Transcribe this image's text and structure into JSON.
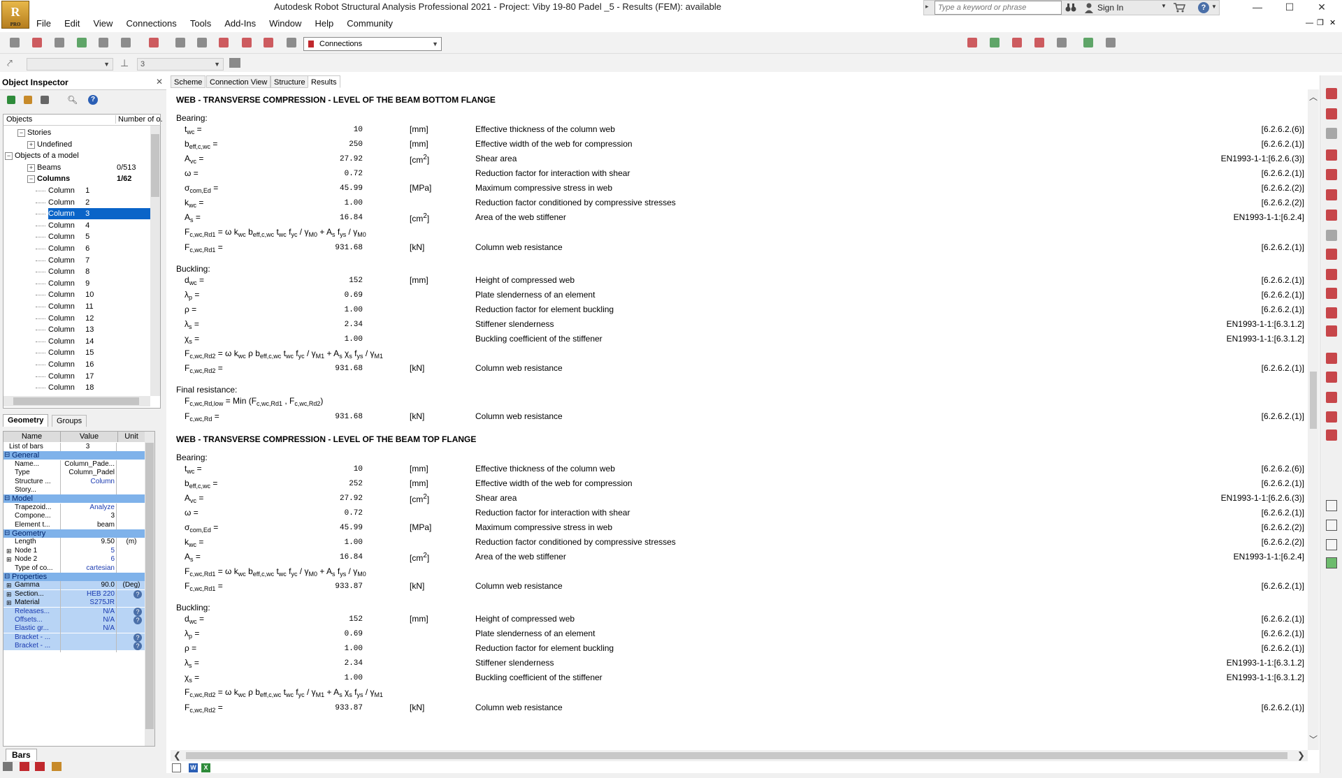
{
  "window": {
    "title": "Autodesk Robot Structural Analysis Professional 2021 - Project: Viby 19-80 Padel _5 - Results (FEM): available",
    "logo": "R",
    "logo_sub": "PRO",
    "search_placeholder": "Type a keyword or phrase",
    "sign_in": "Sign In",
    "minimize": "—",
    "maximize": "☐",
    "close": "✕"
  },
  "menu": [
    "File",
    "Edit",
    "View",
    "Connections",
    "Tools",
    "Add-Ins",
    "Window",
    "Help",
    "Community"
  ],
  "toolbar": {
    "combo_label": "Connections",
    "level_value": "3"
  },
  "inspector": {
    "title": "Object Inspector",
    "close": "✕",
    "col_objects": "Objects",
    "col_number": "Number of o.",
    "tree": [
      {
        "label": "Stories",
        "level": 1,
        "expander": "⊟"
      },
      {
        "label": "Undefined",
        "level": 2,
        "expander": "⊞"
      },
      {
        "label": "Objects of a model",
        "level": 0,
        "expander": "⊟"
      },
      {
        "label": "Beams",
        "level": 2,
        "expander": "⊞",
        "count": "0/513"
      },
      {
        "label": "Columns",
        "level": 2,
        "expander": "⊟",
        "count": "1/62",
        "bold": true
      },
      {
        "label": "Column     1",
        "level": 3
      },
      {
        "label": "Column     2",
        "level": 3
      },
      {
        "label": "Column     3",
        "level": 3,
        "selected": true
      },
      {
        "label": "Column     4",
        "level": 3
      },
      {
        "label": "Column     5",
        "level": 3
      },
      {
        "label": "Column     6",
        "level": 3
      },
      {
        "label": "Column     7",
        "level": 3
      },
      {
        "label": "Column     8",
        "level": 3
      },
      {
        "label": "Column     9",
        "level": 3
      },
      {
        "label": "Column     10",
        "level": 3
      },
      {
        "label": "Column     11",
        "level": 3
      },
      {
        "label": "Column     12",
        "level": 3
      },
      {
        "label": "Column     13",
        "level": 3
      },
      {
        "label": "Column     14",
        "level": 3
      },
      {
        "label": "Column     15",
        "level": 3
      },
      {
        "label": "Column     16",
        "level": 3
      },
      {
        "label": "Column     17",
        "level": 3
      },
      {
        "label": "Column     18",
        "level": 3
      }
    ],
    "tabs": [
      "Geometry",
      "Groups"
    ],
    "props_header": {
      "name": "Name",
      "value": "Value",
      "unit": "Unit"
    },
    "props": [
      {
        "type": "row",
        "name": "List of bars",
        "value": "3",
        "unit": "",
        "shade": "plain"
      },
      {
        "type": "group",
        "name": "General"
      },
      {
        "type": "row",
        "name": "Name...",
        "value": "Column_Pade...",
        "unit": ""
      },
      {
        "type": "row",
        "name": "Type",
        "value": "Column_Padel",
        "unit": ""
      },
      {
        "type": "row",
        "name": "Structure ...",
        "value": "Column",
        "unit": "",
        "blue": true
      },
      {
        "type": "row",
        "name": "Story...",
        "value": "",
        "unit": ""
      },
      {
        "type": "group",
        "name": "Model"
      },
      {
        "type": "row",
        "name": "Trapezoid...",
        "value": "Analyze",
        "unit": "",
        "blue": true
      },
      {
        "type": "row",
        "name": "Compone...",
        "value": "3",
        "unit": ""
      },
      {
        "type": "row",
        "name": "Element t...",
        "value": "beam",
        "unit": ""
      },
      {
        "type": "group",
        "name": "Geometry"
      },
      {
        "type": "row",
        "name": "Length",
        "value": "9.50",
        "unit": "(m)"
      },
      {
        "type": "row",
        "name": "Node 1",
        "value": "5",
        "unit": "",
        "blue": true,
        "exp": true
      },
      {
        "type": "row",
        "name": "Node 2",
        "value": "6",
        "unit": "",
        "blue": true,
        "exp": true
      },
      {
        "type": "row",
        "name": "Type of co...",
        "value": "cartesian",
        "unit": "",
        "blue": true
      },
      {
        "type": "group",
        "name": "Properties"
      },
      {
        "type": "row",
        "name": "Gamma",
        "value": "90.0",
        "unit": "(Deg)",
        "exp": true,
        "sel": true
      },
      {
        "type": "row",
        "name": "Section...",
        "value": "HEB 220",
        "unit": "?",
        "blue": true,
        "exp": true,
        "sel": true
      },
      {
        "type": "row",
        "name": "Material",
        "value": "S275JR",
        "unit": "",
        "blue": true,
        "exp": true,
        "sel": true
      },
      {
        "type": "row",
        "name": "Releases...",
        "value": "N/A",
        "unit": "?",
        "blue": true,
        "sel": true,
        "nblue": true
      },
      {
        "type": "row",
        "name": "Offsets...",
        "value": "N/A",
        "unit": "?",
        "blue": true,
        "sel": true,
        "nblue": true
      },
      {
        "type": "row",
        "name": "Elastic gr...",
        "value": "N/A",
        "unit": "",
        "blue": true,
        "sel": true,
        "nblue": true
      },
      {
        "type": "row",
        "name": "Bracket - ...",
        "value": "",
        "unit": "?",
        "sel": true,
        "nblue": true
      },
      {
        "type": "row",
        "name": "Bracket - ...",
        "value": "",
        "unit": "?",
        "sel": true,
        "nblue": true
      }
    ],
    "bottom_tab": "Bars"
  },
  "view_tabs": [
    "Scheme",
    "Connection View",
    "Structure",
    "Results"
  ],
  "active_view_tab": "Results",
  "content": {
    "sections": [
      {
        "title": "WEB - TRANSVERSE COMPRESSION - LEVEL OF THE BEAM BOTTOM FLANGE",
        "groups": [
          {
            "label": "Bearing:",
            "rows": [
              {
                "sym": "t<sub>wc</sub> =",
                "val": "10",
                "unit": "[mm]",
                "desc": "Effective thickness of the column web",
                "ref": "[6.2.6.2.(6)]"
              },
              {
                "sym": "b<sub>eff,c,wc</sub> =",
                "val": "250",
                "unit": "[mm]",
                "desc": "Effective width of the web for compression",
                "ref": "[6.2.6.2.(1)]"
              },
              {
                "sym": "A<sub>vc</sub> =",
                "val": "27.92",
                "unit": "[cm<sup>2</sup>]",
                "desc": "Shear area",
                "ref": "EN1993-1-1:[6.2.6.(3)]"
              },
              {
                "sym": "ω =",
                "val": "0.72",
                "unit": "",
                "desc": "Reduction factor for interaction with shear",
                "ref": "[6.2.6.2.(1)]"
              },
              {
                "sym": "σ<sub>com,Ed</sub> =",
                "val": "45.99",
                "unit": "[MPa]",
                "desc": "Maximum compressive stress in web",
                "ref": "[6.2.6.2.(2)]"
              },
              {
                "sym": "k<sub>wc</sub> =",
                "val": "1.00",
                "unit": "",
                "desc": "Reduction factor conditioned by compressive stresses",
                "ref": "[6.2.6.2.(2)]"
              },
              {
                "sym": "A<sub>s</sub> =",
                "val": "16.84",
                "unit": "[cm<sup>2</sup>]",
                "desc": "Area of the web stiffener",
                "ref": "EN1993-1-1:[6.2.4]"
              },
              {
                "sym": "F<sub>c,wc,Rd1</sub> = ω k<sub>wc</sub> b<sub>eff,c,wc</sub> t<sub>wc</sub> f<sub>yc</sub> / γ<sub>M0</sub> + A<sub>s</sub> f<sub>ys</sub> / γ<sub>M0</sub>",
                "val": "",
                "unit": "",
                "desc": "",
                "ref": ""
              },
              {
                "sym": "F<sub>c,wc,Rd1</sub> =",
                "val": "931.68",
                "unit": "[kN]",
                "desc": "Column web resistance",
                "ref": "[6.2.6.2.(1)]"
              }
            ]
          },
          {
            "label": "Buckling:",
            "rows": [
              {
                "sym": "d<sub>wc</sub> =",
                "val": "152",
                "unit": "[mm]",
                "desc": "Height of compressed web",
                "ref": "[6.2.6.2.(1)]"
              },
              {
                "sym": "λ<sub>p</sub> =",
                "val": "0.69",
                "unit": "",
                "desc": "Plate slenderness of an element",
                "ref": "[6.2.6.2.(1)]"
              },
              {
                "sym": "ρ =",
                "val": "1.00",
                "unit": "",
                "desc": "Reduction factor for element buckling",
                "ref": "[6.2.6.2.(1)]"
              },
              {
                "sym": "λ<sub>s</sub> =",
                "val": "2.34",
                "unit": "",
                "desc": "Stiffener slenderness",
                "ref": "EN1993-1-1:[6.3.1.2]"
              },
              {
                "sym": "χ<sub>s</sub> =",
                "val": "1.00",
                "unit": "",
                "desc": "Buckling coefficient of the stiffener",
                "ref": "EN1993-1-1:[6.3.1.2]"
              },
              {
                "sym": "F<sub>c,wc,Rd2</sub> = ω k<sub>wc</sub> ρ b<sub>eff,c,wc</sub> t<sub>wc</sub> f<sub>yc</sub> / γ<sub>M1</sub> + A<sub>s</sub> χ<sub>s</sub> f<sub>ys</sub> / γ<sub>M1</sub>",
                "val": "",
                "unit": "",
                "desc": "",
                "ref": ""
              },
              {
                "sym": "F<sub>c,wc,Rd2</sub> =",
                "val": "931.68",
                "unit": "[kN]",
                "desc": "Column web resistance",
                "ref": "[6.2.6.2.(1)]"
              }
            ]
          },
          {
            "label": "Final resistance:",
            "rows": [
              {
                "sym": "F<sub>c,wc,Rd,low</sub> = Min (F<sub>c,wc,Rd1</sub> , F<sub>c,wc,Rd2</sub>)",
                "val": "",
                "unit": "",
                "desc": "",
                "ref": ""
              },
              {
                "sym": "F<sub>c,wc,Rd</sub> =",
                "val": "931.68",
                "unit": "[kN]",
                "desc": "Column web resistance",
                "ref": "[6.2.6.2.(1)]"
              }
            ]
          }
        ]
      },
      {
        "title": "WEB - TRANSVERSE COMPRESSION - LEVEL OF THE BEAM TOP FLANGE",
        "groups": [
          {
            "label": "Bearing:",
            "rows": [
              {
                "sym": "t<sub>wc</sub> =",
                "val": "10",
                "unit": "[mm]",
                "desc": "Effective thickness of the column web",
                "ref": "[6.2.6.2.(6)]"
              },
              {
                "sym": "b<sub>eff,c,wc</sub> =",
                "val": "252",
                "unit": "[mm]",
                "desc": "Effective width of the web for compression",
                "ref": "[6.2.6.2.(1)]"
              },
              {
                "sym": "A<sub>vc</sub> =",
                "val": "27.92",
                "unit": "[cm<sup>2</sup>]",
                "desc": "Shear area",
                "ref": "EN1993-1-1:[6.2.6.(3)]"
              },
              {
                "sym": "ω =",
                "val": "0.72",
                "unit": "",
                "desc": "Reduction factor for interaction with shear",
                "ref": "[6.2.6.2.(1)]"
              },
              {
                "sym": "σ<sub>com,Ed</sub> =",
                "val": "45.99",
                "unit": "[MPa]",
                "desc": "Maximum compressive stress in web",
                "ref": "[6.2.6.2.(2)]"
              },
              {
                "sym": "k<sub>wc</sub> =",
                "val": "1.00",
                "unit": "",
                "desc": "Reduction factor conditioned by compressive stresses",
                "ref": "[6.2.6.2.(2)]"
              },
              {
                "sym": "A<sub>s</sub> =",
                "val": "16.84",
                "unit": "[cm<sup>2</sup>]",
                "desc": "Area of the web stiffener",
                "ref": "EN1993-1-1:[6.2.4]"
              },
              {
                "sym": "F<sub>c,wc,Rd1</sub> = ω k<sub>wc</sub> b<sub>eff,c,wc</sub> t<sub>wc</sub> f<sub>yc</sub> / γ<sub>M0</sub> + A<sub>s</sub> f<sub>ys</sub> / γ<sub>M0</sub>",
                "val": "",
                "unit": "",
                "desc": "",
                "ref": ""
              },
              {
                "sym": "F<sub>c,wc,Rd1</sub> =",
                "val": "933.87",
                "unit": "[kN]",
                "desc": "Column web resistance",
                "ref": "[6.2.6.2.(1)]"
              }
            ]
          },
          {
            "label": "Buckling:",
            "rows": [
              {
                "sym": "d<sub>wc</sub> =",
                "val": "152",
                "unit": "[mm]",
                "desc": "Height of compressed web",
                "ref": "[6.2.6.2.(1)]"
              },
              {
                "sym": "λ<sub>p</sub> =",
                "val": "0.69",
                "unit": "",
                "desc": "Plate slenderness of an element",
                "ref": "[6.2.6.2.(1)]"
              },
              {
                "sym": "ρ =",
                "val": "1.00",
                "unit": "",
                "desc": "Reduction factor for element buckling",
                "ref": "[6.2.6.2.(1)]"
              },
              {
                "sym": "λ<sub>s</sub> =",
                "val": "2.34",
                "unit": "",
                "desc": "Stiffener slenderness",
                "ref": "EN1993-1-1:[6.3.1.2]"
              },
              {
                "sym": "χ<sub>s</sub> =",
                "val": "1.00",
                "unit": "",
                "desc": "Buckling coefficient of the stiffener",
                "ref": "EN1993-1-1:[6.3.1.2]"
              },
              {
                "sym": "F<sub>c,wc,Rd2</sub> = ω k<sub>wc</sub> ρ b<sub>eff,c,wc</sub> t<sub>wc</sub> f<sub>yc</sub> / γ<sub>M1</sub> + A<sub>s</sub> χ<sub>s</sub> f<sub>ys</sub> / γ<sub>M1</sub>",
                "val": "",
                "unit": "",
                "desc": "",
                "ref": ""
              },
              {
                "sym": "F<sub>c,wc,Rd2</sub> =",
                "val": "933.87",
                "unit": "[kN]",
                "desc": "Column web resistance",
                "ref": "[6.2.6.2.(1)]"
              }
            ]
          }
        ]
      }
    ]
  },
  "colors": {
    "selection": "#0a64c8",
    "prop_group": "#7fb2ea",
    "prop_selected": "#b8d4f5",
    "accent_red": "#c0282d"
  }
}
